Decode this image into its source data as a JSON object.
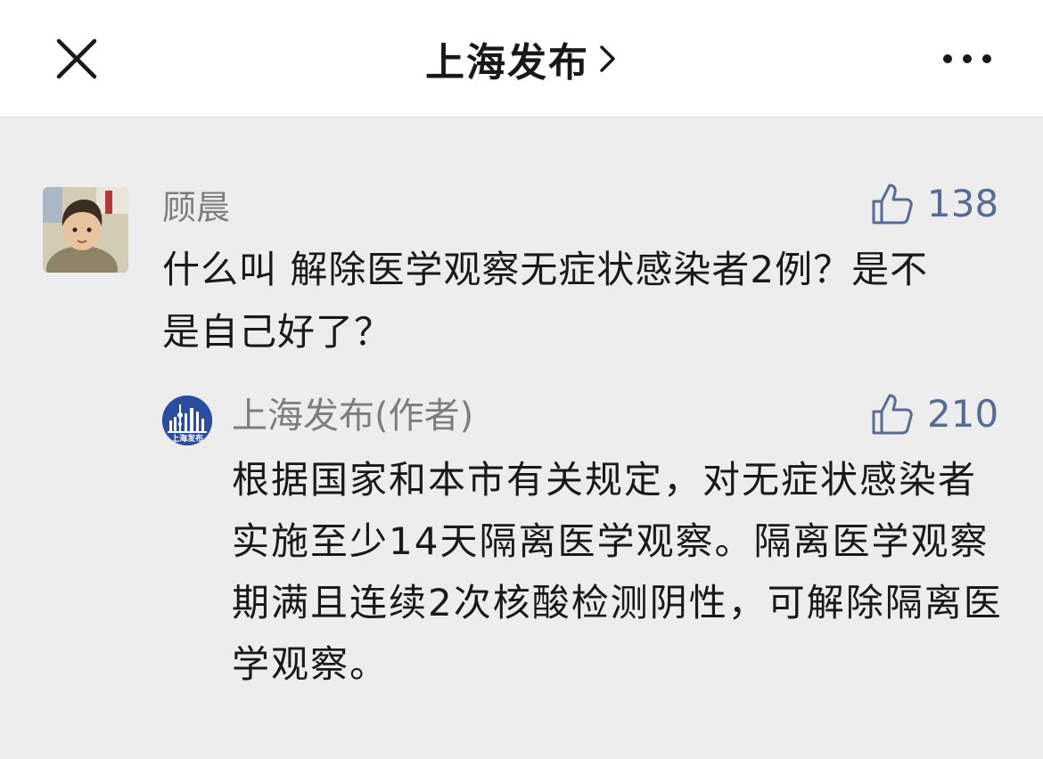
{
  "header": {
    "title": "上海发布",
    "close_icon": "close-icon",
    "chevron_icon": "chevron-right-icon",
    "more_icon": "more-horizontal-icon"
  },
  "comment": {
    "author": "顾晨",
    "avatar": "child-photo-avatar",
    "likes": "138",
    "text": "什么叫 解除医学观察无症状感染者2例？是不是自己好了？"
  },
  "reply": {
    "author": "上海发布(作者)",
    "logo": "shanghai-skyline-logo",
    "logo_text": "上海发布",
    "likes": "210",
    "text": "根据国家和本市有关规定，对无症状感染者实施至少14天隔离医学观察。隔离医学观察期满且连续2次核酸检测阴性，可解除隔离医学观察。"
  },
  "colors": {
    "accent": "#576b95",
    "background": "#ededed",
    "header_bg": "#ffffff",
    "secondary_text": "#7d7d7d",
    "logo_blue": "#2a4da0"
  }
}
